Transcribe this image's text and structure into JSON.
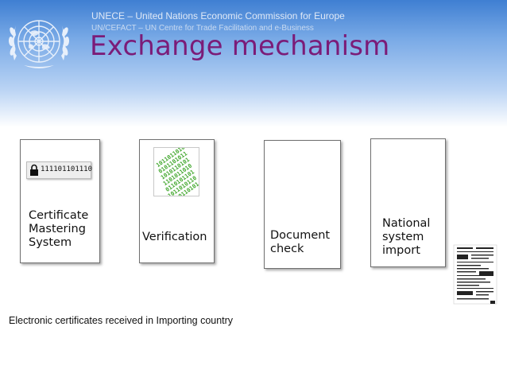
{
  "header": {
    "org_title": "UNECE – United Nations Economic Commission for Europe",
    "org_subtitle": "UN/CEFACT – UN Centre for Trade Facilitation and e-Business",
    "page_title": "Exchange mechanism",
    "logo_icon": "un-emblem-icon",
    "accent_color": "#7b1c78"
  },
  "steps": [
    {
      "label": "Certificate\nMastering\nSystem",
      "badge_text": "111101101110",
      "badge_icon": "lock-icon"
    },
    {
      "label": "Verification",
      "image_icon": "binary-matrix-icon"
    },
    {
      "label": "Document\ncheck"
    },
    {
      "label": "National\nsystem\nimport",
      "image_icon": "scanned-document-icon"
    }
  ],
  "caption": "Electronic certificates received in Importing country"
}
